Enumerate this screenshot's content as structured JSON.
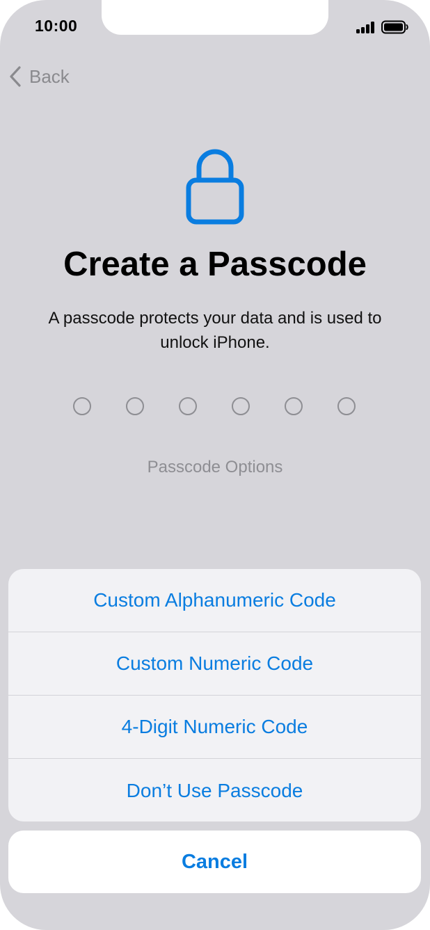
{
  "status_bar": {
    "time": "10:00"
  },
  "nav": {
    "back_label": "Back"
  },
  "header": {
    "title": "Create a Passcode",
    "subtitle": "A passcode protects your data and is used to unlock iPhone."
  },
  "passcode": {
    "digits_total": 6,
    "digits_entered": 0,
    "options_label": "Passcode Options"
  },
  "action_sheet": {
    "items": [
      {
        "label": "Custom Alphanumeric Code"
      },
      {
        "label": "Custom Numeric Code"
      },
      {
        "label": "4-Digit Numeric Code"
      },
      {
        "label": "Don’t Use Passcode"
      }
    ],
    "cancel_label": "Cancel"
  },
  "colors": {
    "accent": "#0a7de0",
    "background": "#d6d5da",
    "sheet": "#f2f2f5",
    "secondary_text": "#8e8e93"
  },
  "icons": {
    "lock": "lock-icon",
    "back": "chevron-left-icon",
    "signal": "cellular-signal-icon",
    "battery": "battery-icon"
  }
}
